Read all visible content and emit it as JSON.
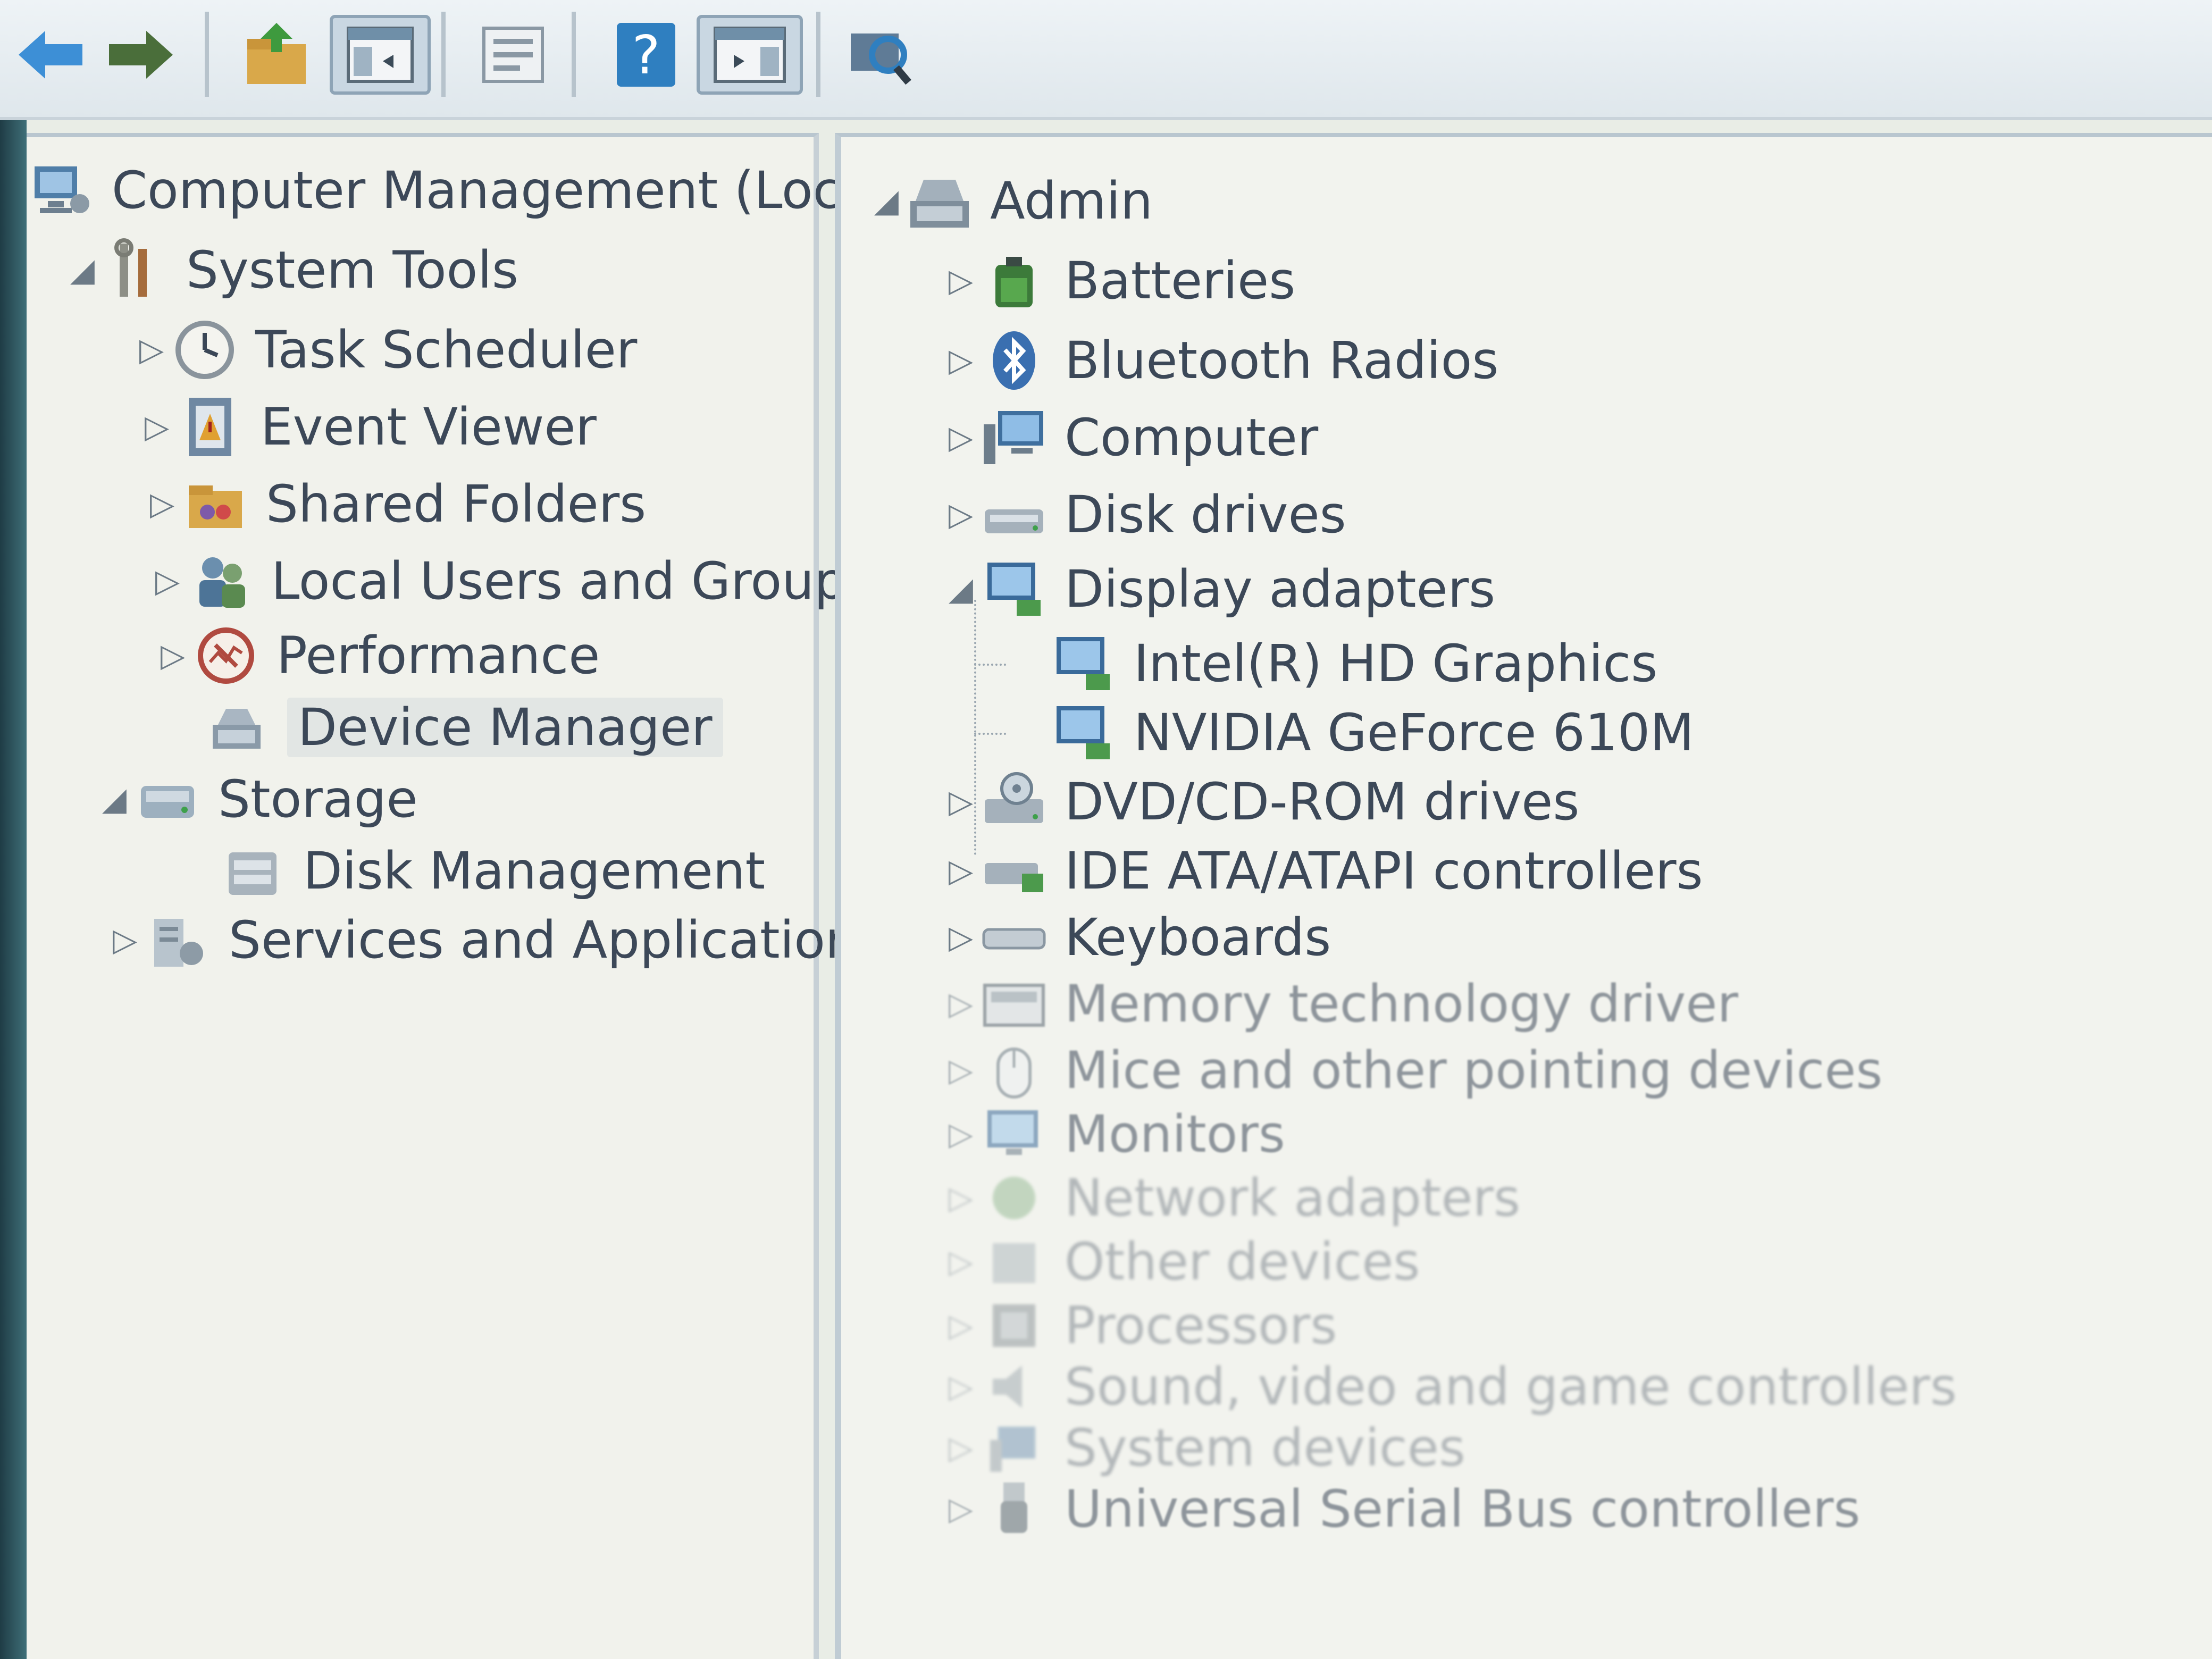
{
  "toolbar": {
    "buttons": [
      {
        "name": "back-button",
        "icon": "back-arrow-icon"
      },
      {
        "name": "forward-button",
        "icon": "forward-arrow-icon"
      },
      {
        "name": "up-folder-button",
        "icon": "up-folder-icon"
      },
      {
        "name": "show-hide-tree-button",
        "icon": "console-tree-icon"
      },
      {
        "name": "properties-button",
        "icon": "properties-icon"
      },
      {
        "name": "help-button",
        "icon": "help-icon",
        "glyph": "?"
      },
      {
        "name": "show-hide-action-pane-button",
        "icon": "action-pane-icon"
      },
      {
        "name": "scan-hardware-button",
        "icon": "scan-hardware-icon"
      }
    ]
  },
  "left_tree": {
    "root": "Computer Management (Local",
    "items": [
      {
        "label": "System Tools",
        "expander": "◢"
      },
      {
        "label": "Task Scheduler",
        "expander": "▷"
      },
      {
        "label": "Event Viewer",
        "expander": "▷"
      },
      {
        "label": "Shared Folders",
        "expander": "▷"
      },
      {
        "label": "Local Users and Groups",
        "expander": "▷"
      },
      {
        "label": "Performance",
        "expander": "▷"
      },
      {
        "label": "Device Manager",
        "expander": ""
      },
      {
        "label": "Storage",
        "expander": "◢"
      },
      {
        "label": "Disk Management",
        "expander": ""
      },
      {
        "label": "Services and Applications",
        "expander": "▷"
      }
    ]
  },
  "device_tree": {
    "root": "Admin",
    "root_expander": "◢",
    "categories": [
      {
        "label": "Batteries",
        "expander": "▷"
      },
      {
        "label": "Bluetooth Radios",
        "expander": "▷"
      },
      {
        "label": "Computer",
        "expander": "▷"
      },
      {
        "label": "Disk drives",
        "expander": "▷"
      },
      {
        "label": "Display adapters",
        "expander": "◢"
      },
      {
        "label": "Intel(R) HD Graphics",
        "expander": ""
      },
      {
        "label": "NVIDIA GeForce 610M",
        "expander": ""
      },
      {
        "label": "DVD/CD-ROM drives",
        "expander": "▷"
      },
      {
        "label": "IDE ATA/ATAPI controllers",
        "expander": "▷"
      },
      {
        "label": "Keyboards",
        "expander": "▷"
      },
      {
        "label": "Memory technology driver",
        "expander": "▷"
      },
      {
        "label": "Mice and other pointing devices",
        "expander": "▷"
      },
      {
        "label": "Monitors",
        "expander": "▷"
      },
      {
        "label": "Network adapters",
        "expander": "▷"
      },
      {
        "label": "Other devices",
        "expander": "▷"
      },
      {
        "label": "Processors",
        "expander": "▷"
      },
      {
        "label": "Sound, video and game controllers",
        "expander": "▷"
      },
      {
        "label": "System devices",
        "expander": "▷"
      },
      {
        "label": "Universal Serial Bus controllers",
        "expander": "▷"
      }
    ]
  },
  "colors": {
    "accent": "#2f7fc0",
    "text": "#3c4858",
    "pane_bg": "#f1f2ec"
  }
}
